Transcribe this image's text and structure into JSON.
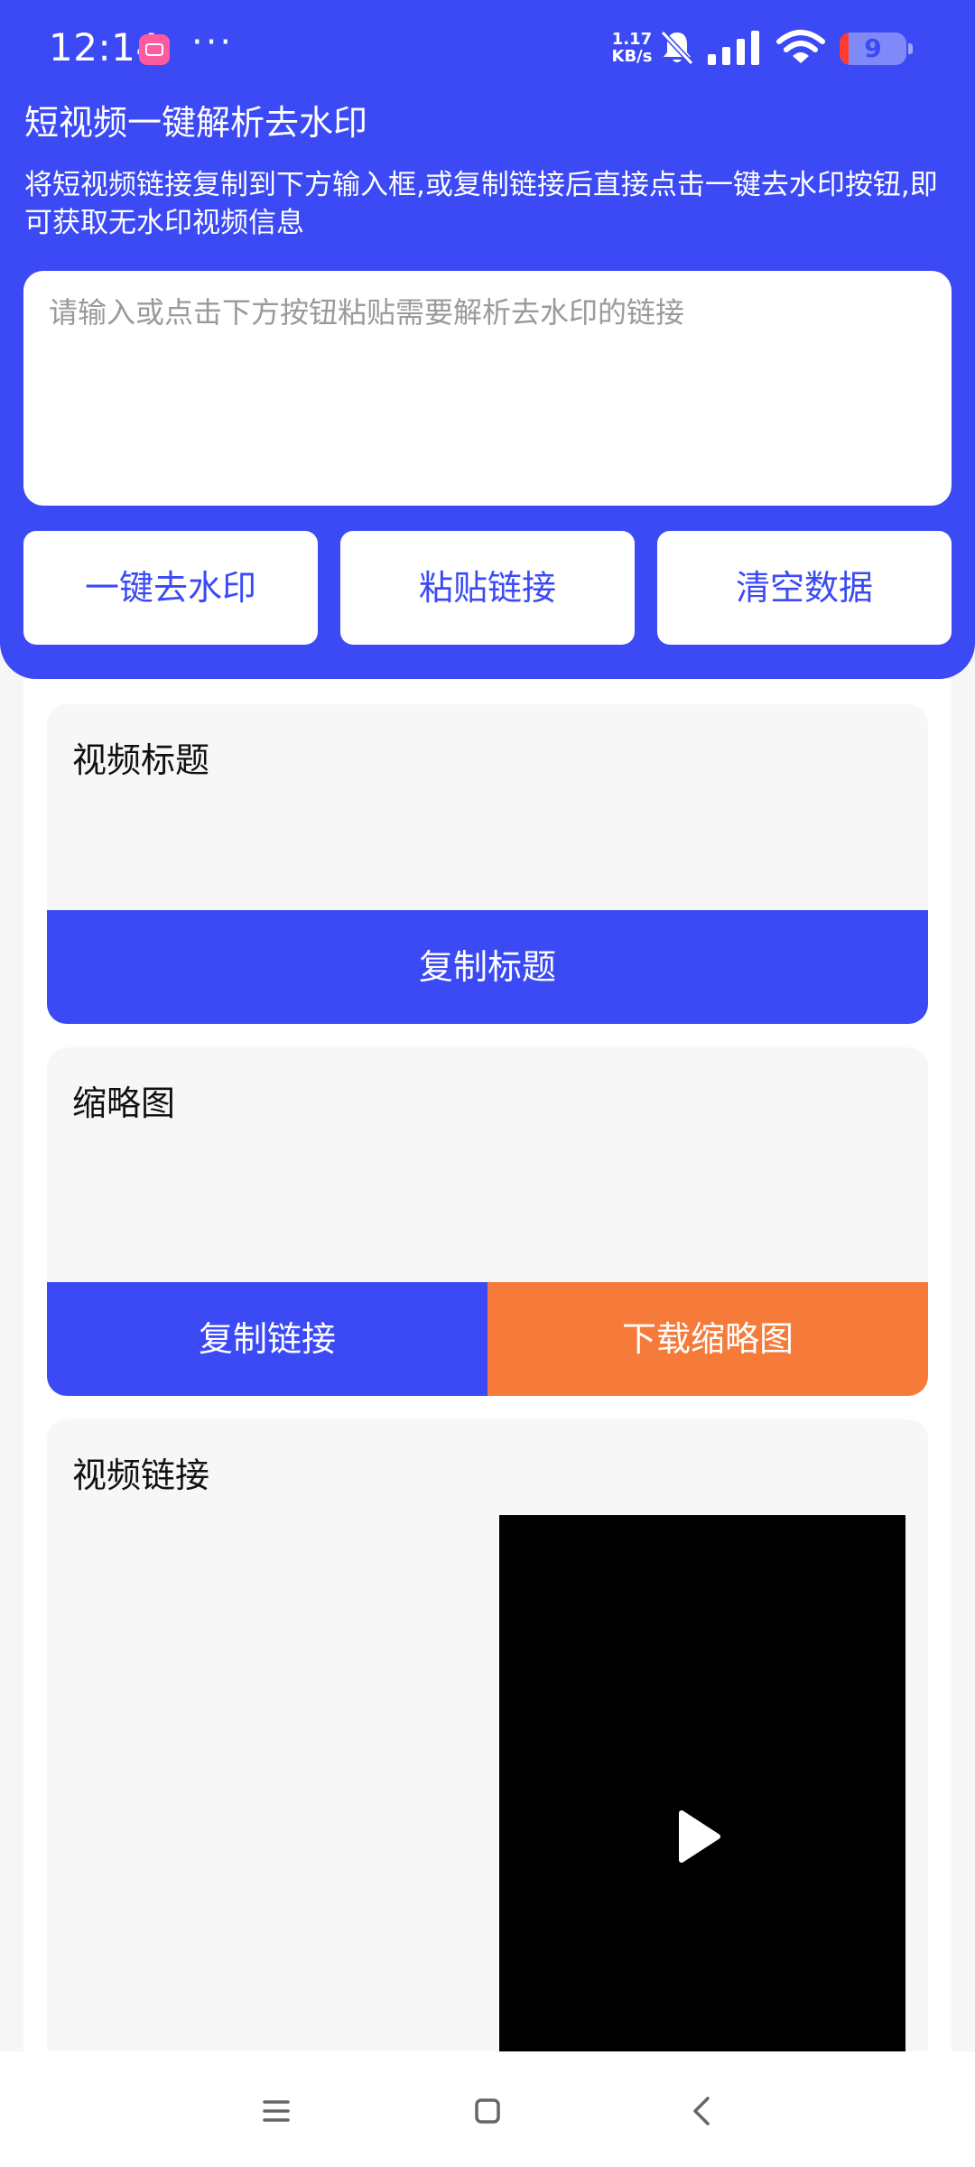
{
  "status_bar": {
    "time": "12:14",
    "dots": "···",
    "net_speed_value": "1.17",
    "net_speed_unit": "KB/s",
    "battery": "9",
    "icons": [
      "app-notification-icon",
      "bell-muted-icon",
      "signal-icon",
      "wifi-icon",
      "battery-icon"
    ]
  },
  "header": {
    "title": "短视频一键解析去水印",
    "description": "将短视频链接复制到下方输入框,或复制链接后直接点击一键去水印按钮,即可获取无水印视频信息"
  },
  "link_input": {
    "value": "",
    "placeholder": "请输入或点击下方按钮粘贴需要解析去水印的链接"
  },
  "actions": {
    "remove_watermark": "一键去水印",
    "paste_link": "粘贴链接",
    "clear_data": "清空数据"
  },
  "title_card": {
    "label": "视频标题",
    "copy_button": "复制标题"
  },
  "thumbnail_card": {
    "label": "缩略图",
    "copy_link_button": "复制链接",
    "download_button": "下载缩略图"
  },
  "video_card": {
    "label": "视频链接",
    "play_icon": "play-icon"
  },
  "navigation": {
    "icons": [
      "menu-icon",
      "home-icon",
      "back-icon"
    ]
  },
  "colors": {
    "primary": "#3b4af5",
    "accent_orange": "#f67b3a",
    "card_bg": "#f7f7f7",
    "page_bg": "#f6f6f6"
  }
}
